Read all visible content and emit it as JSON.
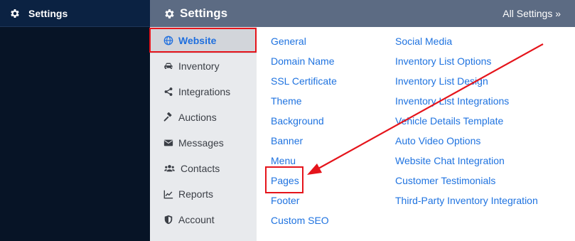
{
  "left_nav": {
    "title": "Settings",
    "icon": "gear-icon"
  },
  "topbar": {
    "title": "Settings",
    "icon": "gear-icon",
    "all_settings": "All Settings »",
    "color": "#5c6b83"
  },
  "subnav": {
    "items": [
      {
        "label": "Website",
        "icon": "globe-icon",
        "active": true
      },
      {
        "label": "Inventory",
        "icon": "car-icon"
      },
      {
        "label": "Integrations",
        "icon": "share-icon"
      },
      {
        "label": "Auctions",
        "icon": "gavel-icon"
      },
      {
        "label": "Messages",
        "icon": "envelope-icon"
      },
      {
        "label": "Contacts",
        "icon": "users-icon"
      },
      {
        "label": "Reports",
        "icon": "chart-icon"
      },
      {
        "label": "Account",
        "icon": "shield-icon"
      }
    ]
  },
  "links": {
    "col1": [
      "General",
      "Domain Name",
      "SSL Certificate",
      "Theme",
      "Background",
      "Banner",
      "Menu",
      "Pages",
      "Footer",
      "Custom SEO"
    ],
    "col2": [
      "Social Media",
      "Inventory List Options",
      "Inventory List Design",
      "Inventory List Integrations",
      "Vehicle Details Template",
      "Auto Video Options",
      "Website Chat Integration",
      "Customer Testimonials",
      "Third-Party Inventory Integration"
    ]
  },
  "colors": {
    "link": "#1f73e0",
    "highlight": "#e5141b",
    "sidebar": "#071426"
  }
}
